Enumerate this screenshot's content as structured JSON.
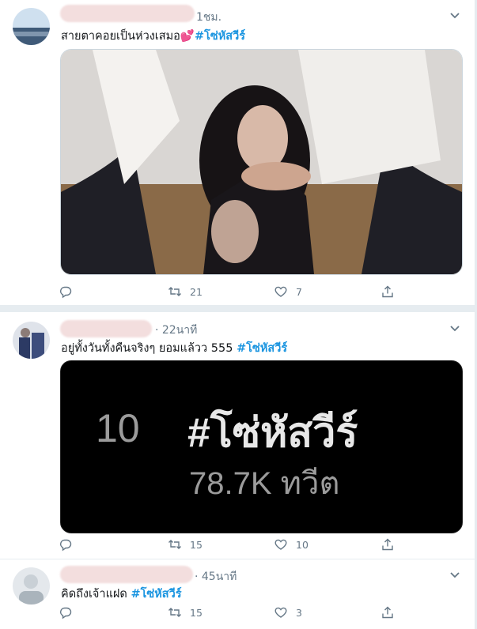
{
  "tweets": [
    {
      "time": "1ชม.",
      "text": "สายตาคอยเป็นห่วงเสมอ",
      "emoji": "💕",
      "hashtag": "#โซ่หัสวีร์",
      "retweets": "21",
      "likes": "7"
    },
    {
      "time": "· 22นาที",
      "text": "อยู่ทั้งวันทั้งคืนจริงๆ ยอมแล้วว 555 ",
      "hashtag": "#โซ่หัสวีร์",
      "retweets": "15",
      "likes": "10",
      "card": {
        "rank": "10",
        "tag": "#โซ่หัสวีร์",
        "count": "78.7K ทวีต"
      }
    },
    {
      "time": "· 45นาที",
      "text": "คิดถึงเจ้าแฝด ",
      "hashtag": "#โซ่หัสวีร์",
      "retweets": "15",
      "likes": "3"
    }
  ],
  "icons": {
    "reply": "reply-icon",
    "retweet": "retweet-icon",
    "like": "heart-icon",
    "share": "share-icon",
    "more": "chevron-down-icon"
  },
  "colors": {
    "link": "#1b95e0",
    "muted": "#657786",
    "border": "#e6ecf0"
  }
}
